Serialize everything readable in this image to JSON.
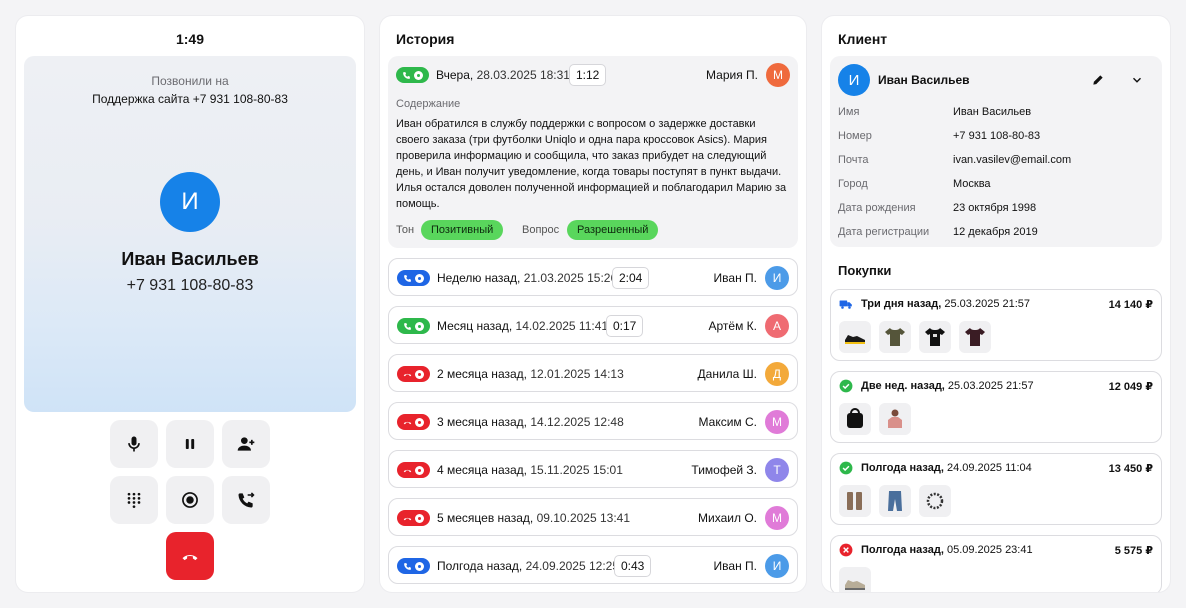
{
  "call": {
    "timer": "1:49",
    "called_label": "Позвонили на",
    "called_target": "Поддержка сайта +7 931 108-80-83",
    "caller_initial": "И",
    "caller_name": "Иван Васильев",
    "caller_phone": "+7 931 108-80-83",
    "controls": [
      "microphone-icon",
      "pause-icon",
      "add-user-icon",
      "dialpad-icon",
      "record-icon",
      "transfer-call-icon",
      "hang-up-icon"
    ]
  },
  "history": {
    "title": "История",
    "expanded": {
      "status": "incoming-answered",
      "relative": "Вчера,",
      "datetime": "28.03.2025 18:31",
      "duration": "1:12",
      "agent": "Мария П.",
      "agent_initial": "М",
      "agent_color": "#ef6a3d",
      "content_label": "Содержание",
      "summary": "Иван обратился в службу поддержки с вопросом о задержке доставки своего заказа (три футболки Uniqlo и одна пара кроссовок Asics). Мария проверила информацию и сообщила, что заказ прибудет на следующий день, и Иван получит уведомление, когда товары поступят в пункт выдачи. Илья остался доволен полученной информацией и поблагодарил Марию за помощь.",
      "tone_label": "Тон",
      "tone_value": "Позитивный",
      "question_label": "Вопрос",
      "question_value": "Разрешенный"
    },
    "rows": [
      {
        "status": "outgoing",
        "relative": "Неделю назад,",
        "datetime": "21.03.2025 15:26",
        "duration": "2:04",
        "agent": "Иван П.",
        "initial": "И",
        "color": "#4c9be8"
      },
      {
        "status": "answered",
        "relative": "Месяц назад,",
        "datetime": "14.02.2025 11:41",
        "duration": "0:17",
        "agent": "Артём К.",
        "initial": "А",
        "color": "#ef6b72"
      },
      {
        "status": "missed",
        "relative": "2 месяца назад,",
        "datetime": "12.01.2025 14:13",
        "duration": "",
        "agent": "Данила Ш.",
        "initial": "Д",
        "color": "#f3a93a"
      },
      {
        "status": "missed",
        "relative": "3 месяца назад,",
        "datetime": "14.12.2025 12:48",
        "duration": "",
        "agent": "Максим С.",
        "initial": "М",
        "color": "#e07bd8"
      },
      {
        "status": "missed",
        "relative": "4 месяца назад,",
        "datetime": "15.11.2025 15:01",
        "duration": "",
        "agent": "Тимофей З.",
        "initial": "Т",
        "color": "#8f86ea"
      },
      {
        "status": "missed",
        "relative": "5 месяцев назад,",
        "datetime": "09.10.2025 13:41",
        "duration": "",
        "agent": "Михаил О.",
        "initial": "М",
        "color": "#e07bd8"
      },
      {
        "status": "outgoing",
        "relative": "Полгода назад,",
        "datetime": "24.09.2025 12:25",
        "duration": "0:43",
        "agent": "Иван П.",
        "initial": "И",
        "color": "#4c9be8"
      }
    ]
  },
  "client": {
    "title": "Клиент",
    "initial": "И",
    "name": "Иван Васильев",
    "fields": [
      {
        "label": "Имя",
        "value": "Иван Васильев"
      },
      {
        "label": "Номер",
        "value": "+7 931 108-80-83"
      },
      {
        "label": "Почта",
        "value": "ivan.vasilev@email.com"
      },
      {
        "label": "Город",
        "value": "Москва"
      },
      {
        "label": "Дата рождения",
        "value": "23 октября 1998"
      },
      {
        "label": "Дата регистрации",
        "value": "12 декабря 2019"
      }
    ],
    "purchases_title": "Покупки",
    "purchases": [
      {
        "status_icon": "delivery-truck-icon",
        "relative": "Три дня назад,",
        "datetime": "25.03.2025 21:57",
        "price": "14 140 ₽",
        "items": [
          "sneaker-icon",
          "tshirt-olive-icon",
          "tshirt-black-icon",
          "tshirt-maroon-icon"
        ]
      },
      {
        "status_icon": "check-circle-icon",
        "relative": "Две нед. назад,",
        "datetime": "25.03.2025 21:57",
        "price": "12 049 ₽",
        "items": [
          "bag-icon",
          "person-shirt-icon"
        ]
      },
      {
        "status_icon": "check-circle-icon",
        "relative": "Полгода назад,",
        "datetime": "24.09.2025 11:04",
        "price": "13 450 ₽",
        "items": [
          "boots-icon",
          "jeans-icon",
          "bracelet-icon"
        ]
      },
      {
        "status_icon": "cancel-circle-icon",
        "relative": "Полгода назад,",
        "datetime": "05.09.2025 23:41",
        "price": "5 575 ₽",
        "items": [
          "sneaker-beige-icon"
        ]
      }
    ]
  },
  "colors": {
    "accent": "#1682e8",
    "green": "#2eb84b",
    "blue": "#1f66e5",
    "red": "#e8232c",
    "tag": "#59d65c"
  }
}
